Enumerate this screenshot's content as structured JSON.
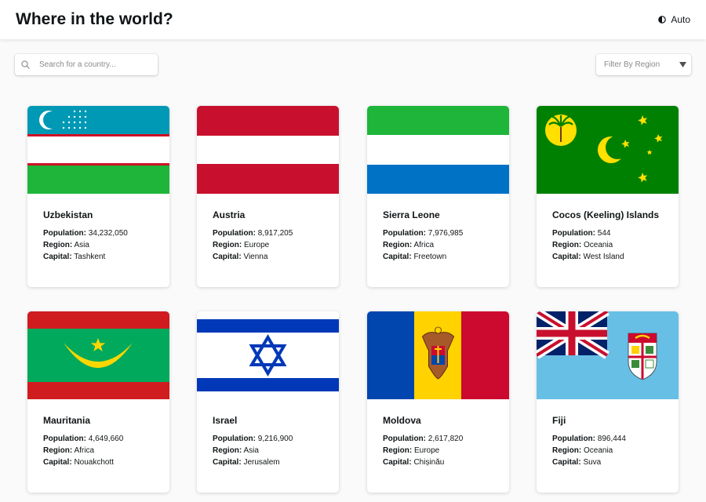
{
  "header": {
    "title": "Where in the world?",
    "theme_label": "Auto",
    "theme_icon": "half-circle-icon"
  },
  "search": {
    "placeholder": "Search for a country...",
    "icon": "search-icon"
  },
  "filter": {
    "label": "Filter By Region",
    "icon": "triangle-down-icon"
  },
  "labels": {
    "population": "Population:",
    "region": "Region:",
    "capital": "Capital:"
  },
  "countries": [
    {
      "name": "Uzbekistan",
      "population": "34,232,050",
      "region": "Asia",
      "capital": "Tashkent",
      "flag": "uzbekistan-flag"
    },
    {
      "name": "Austria",
      "population": "8,917,205",
      "region": "Europe",
      "capital": "Vienna",
      "flag": "austria-flag"
    },
    {
      "name": "Sierra Leone",
      "population": "7,976,985",
      "region": "Africa",
      "capital": "Freetown",
      "flag": "sierra-leone-flag"
    },
    {
      "name": "Cocos (Keeling) Islands",
      "population": "544",
      "region": "Oceania",
      "capital": "West Island",
      "flag": "cocos-keeling-islands-flag"
    },
    {
      "name": "Mauritania",
      "population": "4,649,660",
      "region": "Africa",
      "capital": "Nouakchott",
      "flag": "mauritania-flag"
    },
    {
      "name": "Israel",
      "population": "9,216,900",
      "region": "Asia",
      "capital": "Jerusalem",
      "flag": "israel-flag"
    },
    {
      "name": "Moldova",
      "population": "2,617,820",
      "region": "Europe",
      "capital": "Chișinău",
      "flag": "moldova-flag"
    },
    {
      "name": "Fiji",
      "population": "896,444",
      "region": "Oceania",
      "capital": "Suva",
      "flag": "fiji-flag"
    }
  ],
  "colors": {
    "background": "#fafafa",
    "card": "#ffffff",
    "text": "#111517",
    "placeholder": "#8a8a8a"
  }
}
